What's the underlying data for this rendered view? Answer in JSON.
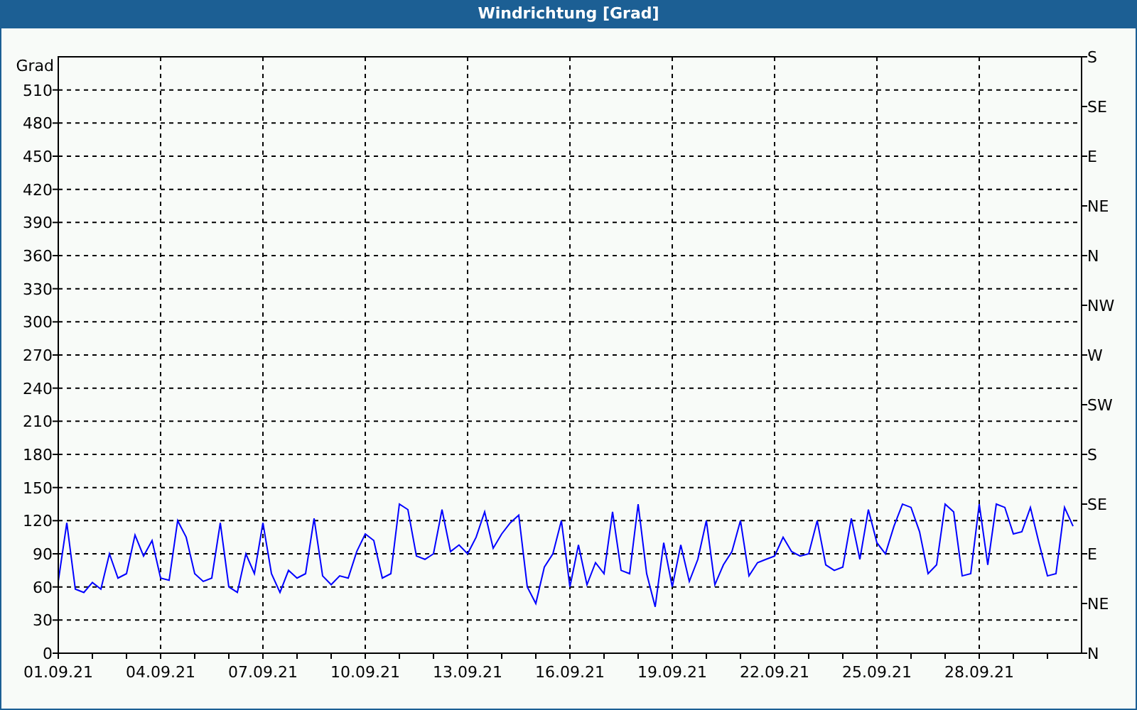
{
  "window": {
    "title": "Windrichtung [Grad]"
  },
  "chart": {
    "chart_data": {
      "type": "line",
      "grid": true,
      "ylabel": "Grad",
      "ylim": [
        0,
        540
      ],
      "yticks": [
        0,
        30,
        60,
        90,
        120,
        150,
        180,
        210,
        240,
        270,
        300,
        330,
        360,
        390,
        420,
        450,
        480,
        510
      ],
      "categories": [
        "01.09.21",
        null,
        null,
        null,
        null,
        null,
        null,
        null,
        null,
        null,
        null,
        null,
        "04.09.21",
        null,
        null,
        null,
        null,
        null,
        null,
        null,
        null,
        null,
        null,
        null,
        "07.09.21",
        null,
        null,
        null,
        null,
        null,
        null,
        null,
        null,
        null,
        null,
        null,
        "10.09.21",
        null,
        null,
        null,
        null,
        null,
        null,
        null,
        null,
        null,
        null,
        null,
        "13.09.21",
        null,
        null,
        null,
        null,
        null,
        null,
        null,
        null,
        null,
        null,
        null,
        "16.09.21",
        null,
        null,
        null,
        null,
        null,
        null,
        null,
        null,
        null,
        null,
        null,
        "19.09.21",
        null,
        null,
        null,
        null,
        null,
        null,
        null,
        null,
        null,
        null,
        null,
        "22.09.21",
        null,
        null,
        null,
        null,
        null,
        null,
        null,
        null,
        null,
        null,
        null,
        "25.09.21",
        null,
        null,
        null,
        null,
        null,
        null,
        null,
        null,
        null,
        null,
        null,
        "28.09.21",
        null,
        null,
        null,
        null,
        null,
        null,
        null,
        null,
        null,
        null,
        null
      ],
      "series": [
        {
          "color": "#0000ff",
          "values": [
            65,
            118,
            58,
            55,
            64,
            58,
            90,
            68,
            72,
            107,
            88,
            102,
            68,
            66,
            120,
            105,
            72,
            65,
            68,
            118,
            60,
            55,
            90,
            72,
            118,
            72,
            55,
            75,
            68,
            72,
            122,
            70,
            62,
            70,
            68,
            92,
            108,
            102,
            68,
            72,
            135,
            130,
            88,
            85,
            90,
            130,
            92,
            98,
            90,
            105,
            128,
            95,
            108,
            118,
            125,
            60,
            45,
            78,
            90,
            120,
            60,
            98,
            62,
            82,
            72,
            128,
            75,
            72,
            135,
            72,
            42,
            100,
            60,
            98,
            65,
            85,
            120,
            62,
            80,
            92,
            120,
            70,
            82,
            85,
            88,
            105,
            92,
            88,
            90,
            120,
            80,
            75,
            78,
            122,
            85,
            130,
            100,
            90,
            115,
            135,
            132,
            110,
            72,
            80,
            135,
            128,
            70,
            72,
            135,
            80,
            135,
            132,
            108,
            110,
            132,
            100,
            70,
            72,
            132,
            115
          ]
        }
      ]
    },
    "compass_labels": [
      "S",
      "SE",
      "E",
      "NE",
      "N",
      "NW",
      "W",
      "SW",
      "S",
      "SE",
      "E",
      "NE",
      "N"
    ]
  }
}
